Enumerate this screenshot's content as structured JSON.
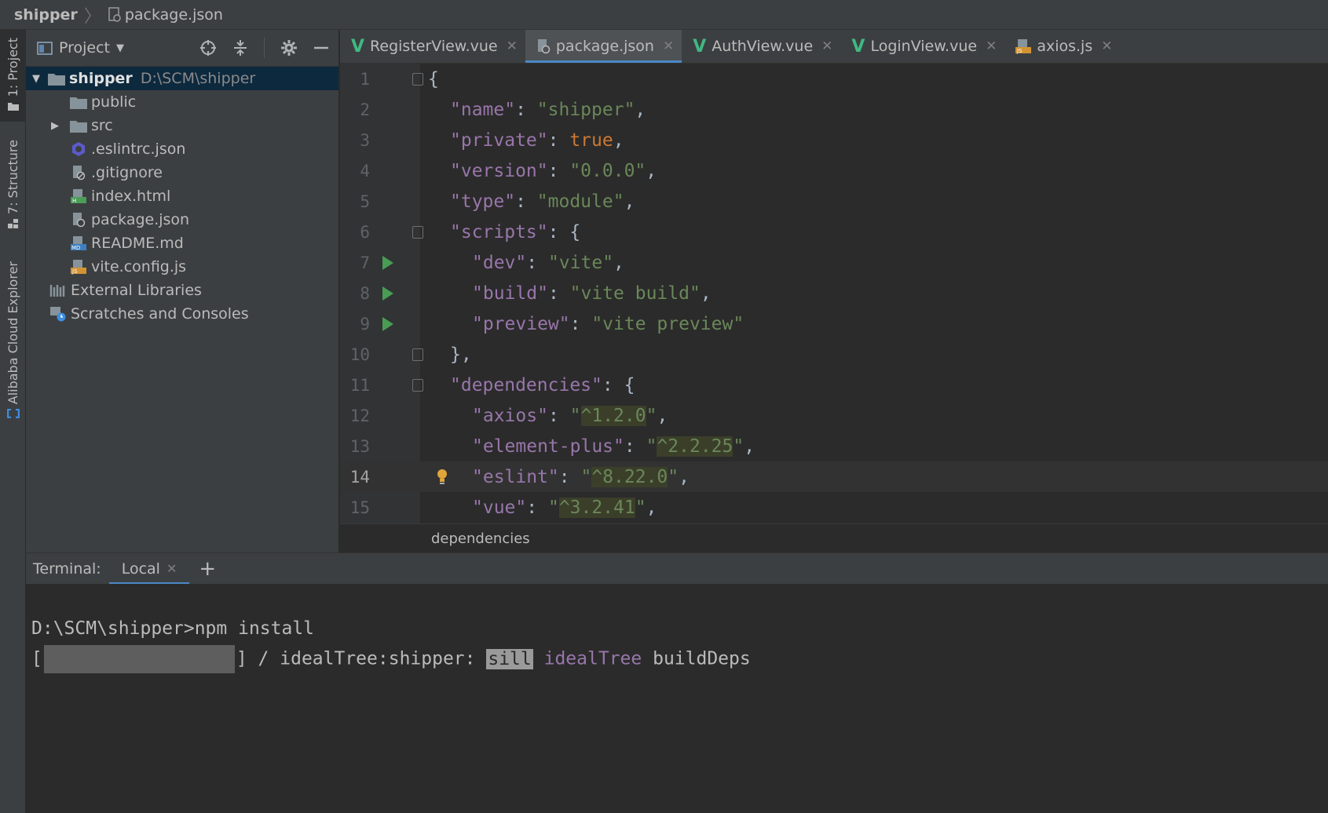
{
  "breadcrumb": {
    "project": "shipper",
    "file": "package.json"
  },
  "toolstrip": {
    "project": "1: Project",
    "structure": "7: Structure",
    "cloud": "Alibaba Cloud Explorer"
  },
  "project_panel": {
    "title": "Project",
    "root": {
      "name": "shipper",
      "path": "D:\\SCM\\shipper"
    },
    "items": [
      {
        "label": "public"
      },
      {
        "label": "src"
      },
      {
        "label": ".eslintrc.json"
      },
      {
        "label": ".gitignore"
      },
      {
        "label": "index.html"
      },
      {
        "label": "package.json"
      },
      {
        "label": "README.md"
      },
      {
        "label": "vite.config.js"
      },
      {
        "label": "External Libraries"
      },
      {
        "label": "Scratches and Consoles"
      }
    ]
  },
  "tabs": [
    {
      "label": "RegisterView.vue"
    },
    {
      "label": "package.json"
    },
    {
      "label": "AuthView.vue"
    },
    {
      "label": "LoginView.vue"
    },
    {
      "label": "axios.js"
    }
  ],
  "editor": {
    "line_numbers": [
      "1",
      "2",
      "3",
      "4",
      "5",
      "6",
      "7",
      "8",
      "9",
      "10",
      "11",
      "12",
      "13",
      "14",
      "15"
    ],
    "lines": {
      "l1_open": "{",
      "name_key": "\"name\"",
      "name_val": "\"shipper\"",
      "private_key": "\"private\"",
      "private_val": "true",
      "version_key": "\"version\"",
      "version_val": "\"0.0.0\"",
      "type_key": "\"type\"",
      "type_val": "\"module\"",
      "scripts_key": "\"scripts\"",
      "dev_key": "\"dev\"",
      "dev_val": "\"vite\"",
      "build_key": "\"build\"",
      "build_val": "\"vite build\"",
      "preview_key": "\"preview\"",
      "preview_val": "\"vite preview\"",
      "close_scripts": "},",
      "deps_key": "\"dependencies\"",
      "axios_key": "\"axios\"",
      "axios_ver": "^1.2.0",
      "ep_key": "\"element-plus\"",
      "ep_ver": "^2.2.25",
      "eslint_key": "\"eslint\"",
      "eslint_ver": "^8.22.0",
      "vue_key": "\"vue\"",
      "vue_ver": "^3.2.41"
    },
    "breadcrumb": "dependencies"
  },
  "terminal": {
    "label": "Terminal:",
    "tab": "Local",
    "command_line": "D:\\SCM\\shipper>npm install",
    "status_prefix": "] / idealTree:shipper: ",
    "sill": "sill",
    "ideal": "idealTree",
    "build_deps": "buildDeps"
  },
  "colors": {
    "accent": "#4a88c7",
    "vue": "#41b883",
    "run": "#499c54",
    "key": "#9876aa",
    "string": "#6a8759",
    "keyword": "#cc7832"
  }
}
